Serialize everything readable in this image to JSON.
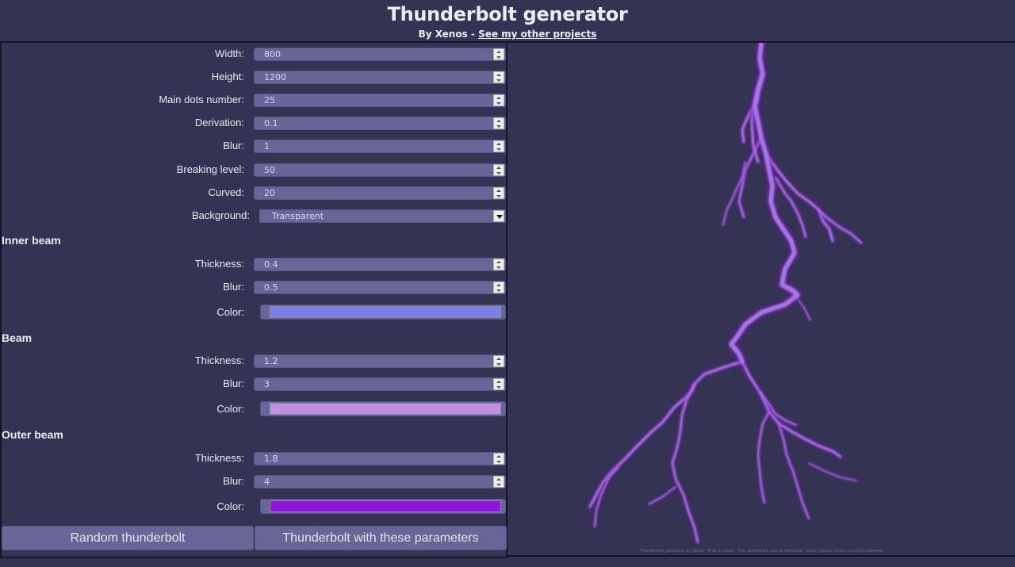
{
  "header": {
    "title": "Thunderbolt generator",
    "byline": "By Xenos - ",
    "link_label": "See my other projects"
  },
  "params": {
    "width": {
      "label": "Width:",
      "value": "800"
    },
    "height": {
      "label": "Height:",
      "value": "1200"
    },
    "main_dots": {
      "label": "Main dots number:",
      "value": "25"
    },
    "derivation": {
      "label": "Derivation:",
      "value": "0.1"
    },
    "blur": {
      "label": "Blur:",
      "value": "1"
    },
    "breaking_level": {
      "label": "Breaking level:",
      "value": "50"
    },
    "curved": {
      "label": "Curved:",
      "value": "20"
    },
    "background": {
      "label": "Background:",
      "value": "Transparent"
    }
  },
  "inner_beam": {
    "heading": "Inner beam",
    "thickness": {
      "label": "Thickness:",
      "value": "0.4"
    },
    "blur": {
      "label": "Blur:",
      "value": "0.5"
    },
    "color": {
      "label": "Color:",
      "value": "#7b80e8"
    }
  },
  "beam": {
    "heading": "Beam",
    "thickness": {
      "label": "Thickness:",
      "value": "1.2"
    },
    "blur": {
      "label": "Blur:",
      "value": "3"
    },
    "color": {
      "label": "Color:",
      "value": "#c48fe0"
    }
  },
  "outer_beam": {
    "heading": "Outer beam",
    "thickness": {
      "label": "Thickness:",
      "value": "1.8"
    },
    "blur": {
      "label": "Blur:",
      "value": "4"
    },
    "color": {
      "label": "Color:",
      "value": "#8a18d4"
    }
  },
  "buttons": {
    "random": "Random thunderbolt",
    "with_params": "Thunderbolt with these parameters"
  },
  "preview": {
    "watermark": "Thunderbolt generator by Xenos - Free to reuse - This watermark can be removed - https://xenos.reinom.com/thunderbolt/"
  }
}
